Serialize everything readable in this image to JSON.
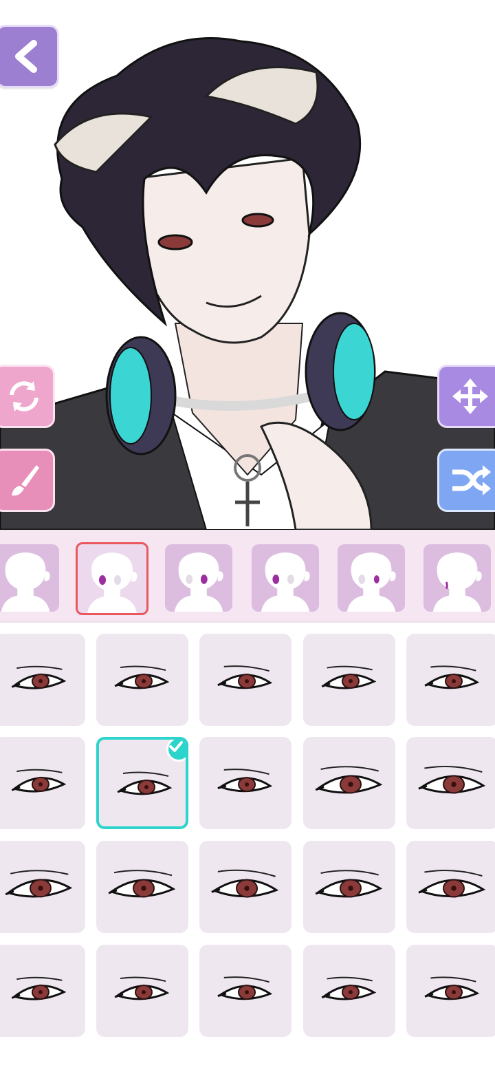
{
  "toolbar": {
    "back": "back-icon",
    "rotate": "rotate-icon",
    "paint": "brush-icon",
    "move": "move-icon",
    "shuffle": "shuffle-icon"
  },
  "categories": {
    "selected_index": 1,
    "items": [
      "face-blank",
      "eyes",
      "eyes-right",
      "eyes-left",
      "eyes-small",
      "mouth"
    ]
  },
  "eye_options": {
    "selected_index": 6,
    "count": 20
  },
  "colors": {
    "accent_select": "#2dd4cc",
    "category_select": "#e8585e",
    "iris": "#8b3a3a"
  }
}
